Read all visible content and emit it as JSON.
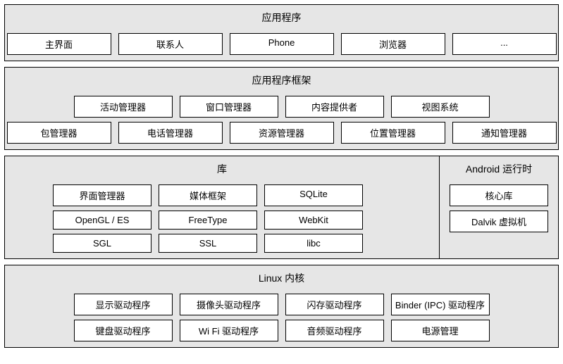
{
  "applications": {
    "title": "应用程序",
    "row1": [
      "主界面",
      "联系人",
      "Phone",
      "浏览器",
      "..."
    ]
  },
  "framework": {
    "title": "应用程序框架",
    "row1": [
      "活动管理器",
      "窗口管理器",
      "内容提供者",
      "视图系统"
    ],
    "row2": [
      "包管理器",
      "电话管理器",
      "资源管理器",
      "位置管理器",
      "通知管理器"
    ]
  },
  "libraries": {
    "title": "库",
    "row1": [
      "界面管理器",
      "媒体框架",
      "SQLite"
    ],
    "row2": [
      "OpenGL / ES",
      "FreeType",
      "WebKit"
    ],
    "row3": [
      "SGL",
      "SSL",
      "libc"
    ]
  },
  "runtime": {
    "title": "Android 运行时",
    "row1": [
      "核心库"
    ],
    "row2": [
      "Dalvik 虚拟机"
    ]
  },
  "kernel": {
    "title": "Linux 内核",
    "row1": [
      "显示驱动程序",
      "摄像头驱动程序",
      "闪存驱动程序",
      "Binder (IPC) 驱动程序"
    ],
    "row2": [
      "键盘驱动程序",
      "Wi Fi 驱动程序",
      "音频驱动程序",
      "电源管理"
    ]
  }
}
